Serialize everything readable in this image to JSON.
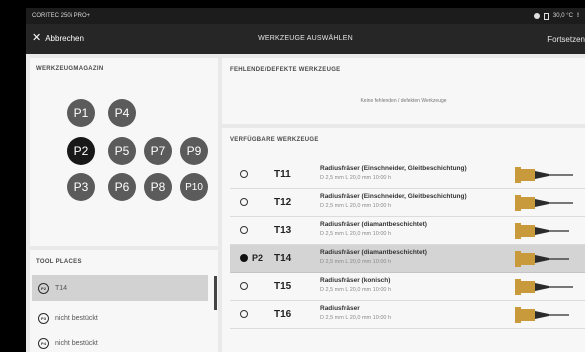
{
  "statusbar": {
    "device": "CORITEC 250i PRO+",
    "temp": "30,0 °C",
    "alert": "!"
  },
  "header": {
    "back_label": "Abbrechen",
    "title": "WERKZEUGE AUSWÄHLEN",
    "next_label": "Fortsetzen"
  },
  "magazine": {
    "title": "WERKZEUGMAGAZIN",
    "positions": [
      "P1",
      "P4",
      "P2",
      "P5",
      "P7",
      "P9",
      "P3",
      "P6",
      "P8",
      "P10"
    ],
    "active": "P2"
  },
  "places": {
    "title": "TOOL PLACES",
    "items": [
      {
        "pos": "P2",
        "label": "T14"
      },
      {
        "pos": "P3",
        "label": "nicht bestückt"
      },
      {
        "pos": "P4",
        "label": "nicht bestückt"
      }
    ]
  },
  "missing": {
    "title": "FEHLENDE/DEFEKTE WERKZEUGE",
    "message": "Keine fehlenden / defekten Werkzeuge"
  },
  "available": {
    "title": "VERFÜGBARE WERKZEUGE",
    "tools": [
      {
        "id": "T11",
        "place": "",
        "name": "Radiusfräser (Einschneider, Gleitbeschichtung)",
        "dims": "D 2,5 mm L 20,0 mm 10:00 h",
        "selected": false
      },
      {
        "id": "T12",
        "place": "",
        "name": "Radiusfräser (Einschneider, Gleitbeschichtung)",
        "dims": "D 2,5 mm L 20,0 mm 10:00 h",
        "selected": false
      },
      {
        "id": "T13",
        "place": "",
        "name": "Radiusfräser (diamantbeschichtet)",
        "dims": "D 2,5 mm L 20,0 mm 10:00 h",
        "selected": false
      },
      {
        "id": "T14",
        "place": "P2",
        "name": "Radiusfräser (diamantbeschichtet)",
        "dims": "D 2,5 mm L 20,0 mm 10:00 h",
        "selected": true
      },
      {
        "id": "T15",
        "place": "",
        "name": "Radiusfräser (konisch)",
        "dims": "D 2,5 mm L 20,0 mm 10:00 h",
        "selected": false
      },
      {
        "id": "T16",
        "place": "",
        "name": "Radiusfräser",
        "dims": "D 2,5 mm L 20,0 mm 10:00 h",
        "selected": false
      }
    ]
  },
  "colors": {
    "active_position": "#181818",
    "position": "#5b5b5b",
    "selected_row": "#d4d4d4",
    "tool_gold": "#c99a3c",
    "tool_shank": "#2b2b2b"
  }
}
